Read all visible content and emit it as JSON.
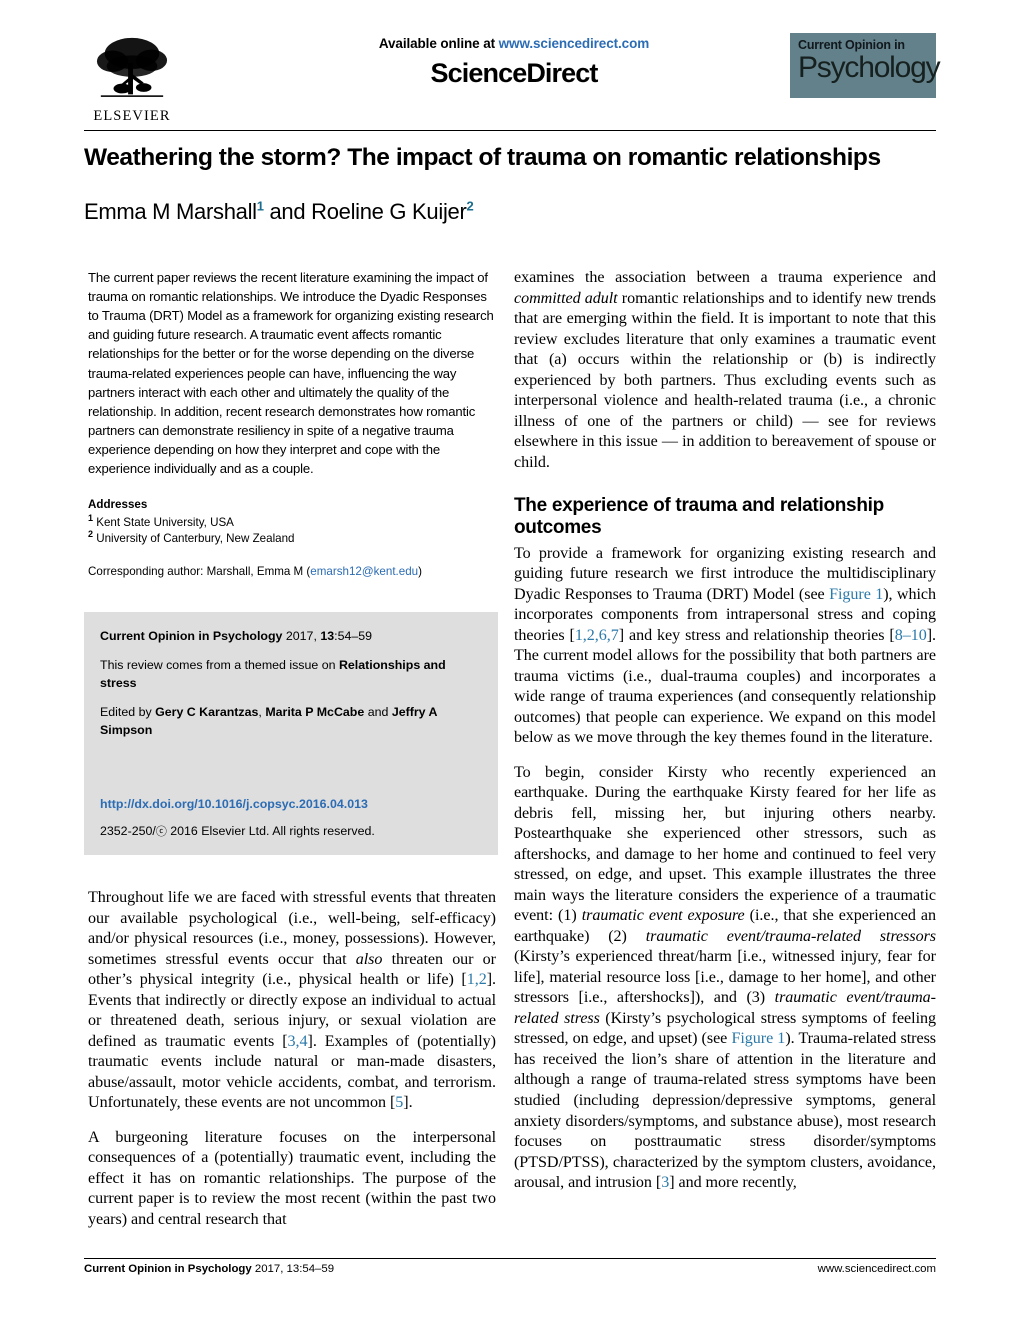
{
  "header": {
    "available_online": "Available online at ",
    "sciencedirect_url": "www.sciencedirect.com",
    "sciencedirect_wordmark": "ScienceDirect",
    "elsevier_wordmark": "ELSEVIER",
    "journal_logo_top": "Current Opinion in",
    "journal_logo_bottom": "Psychology",
    "journal_logo_bg": "#63818a"
  },
  "article": {
    "title": "Weathering the storm? The impact of trauma on romantic relationships",
    "authors_part1": "Emma M Marshall",
    "authors_sup1": "1",
    "authors_conj": " and Roeline G Kuijer",
    "authors_sup2": "2"
  },
  "abstract": {
    "text": "The current paper reviews the recent literature examining the impact of trauma on romantic relationships. We introduce the Dyadic Responses to Trauma (DRT) Model as a framework for organizing existing research and guiding future research. A traumatic event affects romantic relationships for the better or for the worse depending on the diverse trauma-related experiences people can have, influencing the way partners interact with each other and ultimately the quality of the relationship. In addition, recent research demonstrates how romantic partners can demonstrate resiliency in spite of a negative trauma experience depending on how they interpret and cope with the experience individually and as a couple."
  },
  "addresses": {
    "label": "Addresses",
    "items": [
      {
        "sup": "1",
        "text": "Kent State University, USA"
      },
      {
        "sup": "2",
        "text": "University of Canterbury, New Zealand"
      }
    ],
    "corresponding_label": "Corresponding author: Marshall, Emma M (",
    "corresponding_email": "emarsh12@kent.edu",
    "corresponding_close": ")"
  },
  "infobox": {
    "journal_name": "Current Opinion in Psychology",
    "year_vol": " 2017, ",
    "volume": "13",
    "pages": ":54–59",
    "themed_issue_pre": "This review comes from a themed issue on ",
    "themed_issue_name": "Relationships and stress",
    "edited_by_pre": "Edited by ",
    "editor1": "Gery C Karantzas",
    "editor_sep1": ", ",
    "editor2": "Marita P McCabe",
    "editor_sep2": " and ",
    "editor3": "Jeffry A Simpson",
    "doi": "http://dx.doi.org/10.1016/j.copsyc.2016.04.013",
    "issn_pre": "2352-250/",
    "copyright_mark": "ⓒ",
    "issn_post": " 2016 Elsevier Ltd. All rights reserved."
  },
  "left_column": {
    "paragraphs": [
      {
        "segments": [
          {
            "type": "text",
            "value": "Throughout life we are faced with stressful events that threaten our available psychological (i.e., well-being, self-efficacy) and/or physical resources (i.e., money, possessions). However, sometimes stressful events occur that "
          },
          {
            "type": "italic",
            "value": "also"
          },
          {
            "type": "text",
            "value": " threaten our or other’s physical integrity (i.e., physical health or life) ["
          },
          {
            "type": "ref",
            "value": "1,2"
          },
          {
            "type": "text",
            "value": "]. Events that indirectly or directly expose an individual to actual or threatened death, serious injury, or sexual violation are defined as traumatic events ["
          },
          {
            "type": "ref",
            "value": "3,4"
          },
          {
            "type": "text",
            "value": "]. Examples of (potentially) traumatic events include natural or man-made disasters, abuse/assault, motor vehicle accidents, combat, and terrorism. Unfortunately, these events are not uncommon ["
          },
          {
            "type": "ref",
            "value": "5"
          },
          {
            "type": "text",
            "value": "]."
          }
        ]
      },
      {
        "segments": [
          {
            "type": "text",
            "value": "A burgeoning literature focuses on the interpersonal consequences of a (potentially) traumatic event, including the effect it has on romantic relationships. The purpose of the current paper is to review the most recent (within the past two years) and central research that"
          }
        ]
      }
    ]
  },
  "right_column": {
    "paragraphs": [
      {
        "segments": [
          {
            "type": "text",
            "value": "examines the association between a trauma experience and "
          },
          {
            "type": "italic",
            "value": "committed adult"
          },
          {
            "type": "text",
            "value": " romantic relationships and to identify new trends that are emerging within the field. It is important to note that this review excludes literature that only examines a traumatic event that (a) occurs within the relationship or (b) is indirectly experienced by both partners. Thus excluding events such as interpersonal violence and health-related trauma (i.e., a chronic illness of one of the partners or child) — see for reviews elsewhere in this issue — in addition to bereavement of spouse or child."
          }
        ]
      }
    ],
    "section_heading": "The experience of trauma and relationship outcomes",
    "section_paragraphs": [
      {
        "segments": [
          {
            "type": "text",
            "value": "To provide a framework for organizing existing research and guiding future research we first introduce the multidisciplinary Dyadic Responses to Trauma (DRT) Model (see "
          },
          {
            "type": "figlink",
            "value": "Figure 1"
          },
          {
            "type": "text",
            "value": "), which incorporates components from intrapersonal stress and coping theories ["
          },
          {
            "type": "ref",
            "value": "1,2,6,7"
          },
          {
            "type": "text",
            "value": "] and key stress and relationship theories ["
          },
          {
            "type": "ref",
            "value": "8–10"
          },
          {
            "type": "text",
            "value": "]. The current model allows for the possibility that both partners are trauma victims (i.e., dual-trauma couples) and incorporates a wide range of trauma experiences (and consequently relationship outcomes) that people can experience. We expand on this model below as we move through the key themes found in the literature."
          }
        ]
      },
      {
        "segments": [
          {
            "type": "text",
            "value": "To begin, consider Kirsty who recently experienced an earthquake. During the earthquake Kirsty feared for her life as debris fell, missing her, but injuring others nearby. Postearthquake she experienced other stressors, such as aftershocks, and damage to her home and continued to feel very stressed, on edge, and upset. This example illustrates the three main ways the literature considers the experience of a traumatic event: (1) "
          },
          {
            "type": "italic",
            "value": "traumatic event exposure"
          },
          {
            "type": "text",
            "value": " (i.e., that she experienced an earthquake) (2) "
          },
          {
            "type": "italic",
            "value": "traumatic event/trauma-related stressors"
          },
          {
            "type": "text",
            "value": " (Kirsty’s experienced threat/harm [i.e., witnessed injury, fear for life], material resource loss [i.e., damage to her home], and other stressors [i.e., aftershocks]), and (3) "
          },
          {
            "type": "italic",
            "value": "traumatic event/trauma-related stress"
          },
          {
            "type": "text",
            "value": " (Kirsty’s psychological stress symptoms of feeling stressed, on edge, and upset) (see "
          },
          {
            "type": "figlink",
            "value": "Figure 1"
          },
          {
            "type": "text",
            "value": "). Trauma-related stress has received the lion’s share of attention in the literature and although a range of trauma-related stress symptoms have been studied (including depression/depressive symptoms, general anxiety disorders/symptoms, and substance abuse), most research focuses on posttraumatic stress disorder/symptoms (PTSD/PTSS), characterized by the symptom clusters, avoidance, arousal, and intrusion ["
          },
          {
            "type": "ref",
            "value": "3"
          },
          {
            "type": "text",
            "value": "] and more recently,"
          }
        ]
      }
    ]
  },
  "footer": {
    "journal": "Current Opinion in Psychology",
    "citation": " 2017, 13:54–59",
    "website": "www.sciencedirect.com"
  },
  "colors": {
    "link": "#2b6cb4",
    "reference": "#2b79a8",
    "infobox_bg": "#dedede",
    "logo_bg": "#63818a",
    "superscript": "#1a6d8f"
  }
}
